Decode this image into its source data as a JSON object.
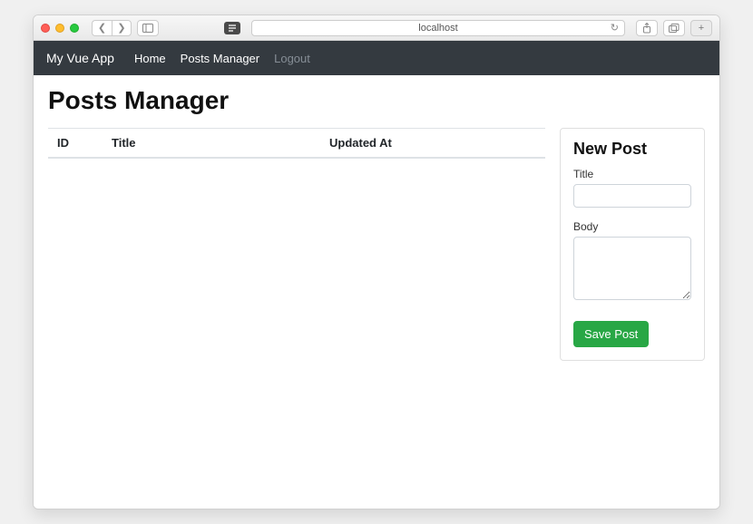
{
  "browser": {
    "url": "localhost"
  },
  "navbar": {
    "brand": "My Vue App",
    "links": {
      "home": "Home",
      "posts": "Posts Manager",
      "logout": "Logout"
    }
  },
  "page": {
    "title": "Posts Manager"
  },
  "table": {
    "columns": {
      "id": "ID",
      "title": "Title",
      "updated_at": "Updated At"
    },
    "rows": []
  },
  "form": {
    "heading": "New Post",
    "title_label": "Title",
    "body_label": "Body",
    "save_button": "Save Post"
  }
}
